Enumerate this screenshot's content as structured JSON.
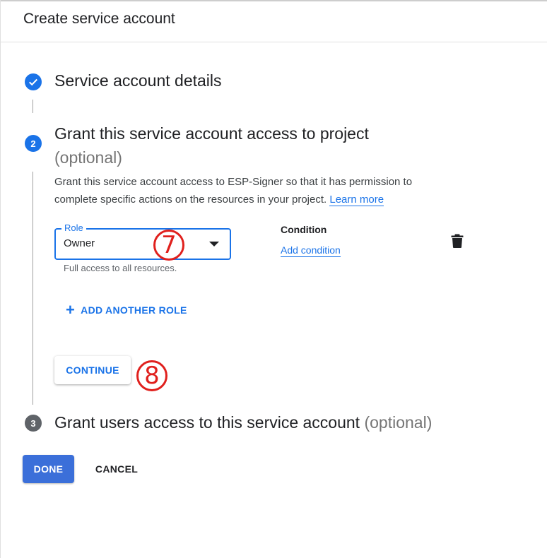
{
  "header": {
    "title": "Create service account"
  },
  "steps": [
    {
      "number": "",
      "state": "done",
      "icon": "check-icon",
      "title": "Service account details"
    },
    {
      "number": "2",
      "state": "active",
      "title": "Grant this service account access to project",
      "optional": "(optional)",
      "description": "Grant this service account access to ESP-Signer so that it has permission to complete specific actions on the resources in your project.",
      "learn_more": "Learn more"
    },
    {
      "number": "3",
      "state": "inactive",
      "title": "Grant users access to this service account",
      "optional": "(optional)"
    }
  ],
  "role": {
    "label": "Role",
    "value": "Owner",
    "hint": "Full access to all resources.",
    "icon": "dropdown-arrow-icon"
  },
  "condition": {
    "label": "Condition",
    "link": "Add condition"
  },
  "delete_icon": "trash-icon",
  "add_role": {
    "icon": "plus-icon",
    "label": "ADD ANOTHER ROLE"
  },
  "buttons": {
    "continue": "CONTINUE",
    "done": "DONE",
    "cancel": "CANCEL"
  },
  "annotations": {
    "first": "7",
    "second": "8",
    "color": "#e0201d"
  },
  "colors": {
    "accent": "#1a73e8",
    "primary_button": "#3b6fd9",
    "inactive_step": "#5f6368"
  }
}
